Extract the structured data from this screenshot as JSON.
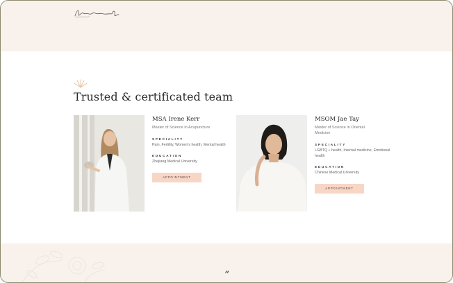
{
  "section": {
    "title": "Trusted & certificated team"
  },
  "team": [
    {
      "name": "MSA Irene Kerr",
      "degree": "Master of Science in Acupuncture",
      "speciality_label": "SPECIALITY",
      "speciality": "Pain, Fertility, Women's health, Mental health",
      "education_label": "EDUCATION",
      "education": "Zhejiang Medical University",
      "appointment_label": "APPOINTMENT"
    },
    {
      "name": "MSOM Jae Tay",
      "degree": "Master of Science in Oriental Medicine",
      "speciality_label": "SPECIALITY",
      "speciality": "LGBTQ + health, Internal medicine, Emotional health",
      "education_label": "EDUCATION",
      "education": "Chinese Medical University",
      "appointment_label": "APPOINTMENT"
    }
  ],
  "testimonial": {
    "quote_mark": "”"
  },
  "colors": {
    "band": "#f8f1ec",
    "button": "#f8d6c5",
    "accent": "#e8c3a8"
  },
  "icons": [
    "signature-logo",
    "sunburst-icon",
    "floral-decoration"
  ]
}
